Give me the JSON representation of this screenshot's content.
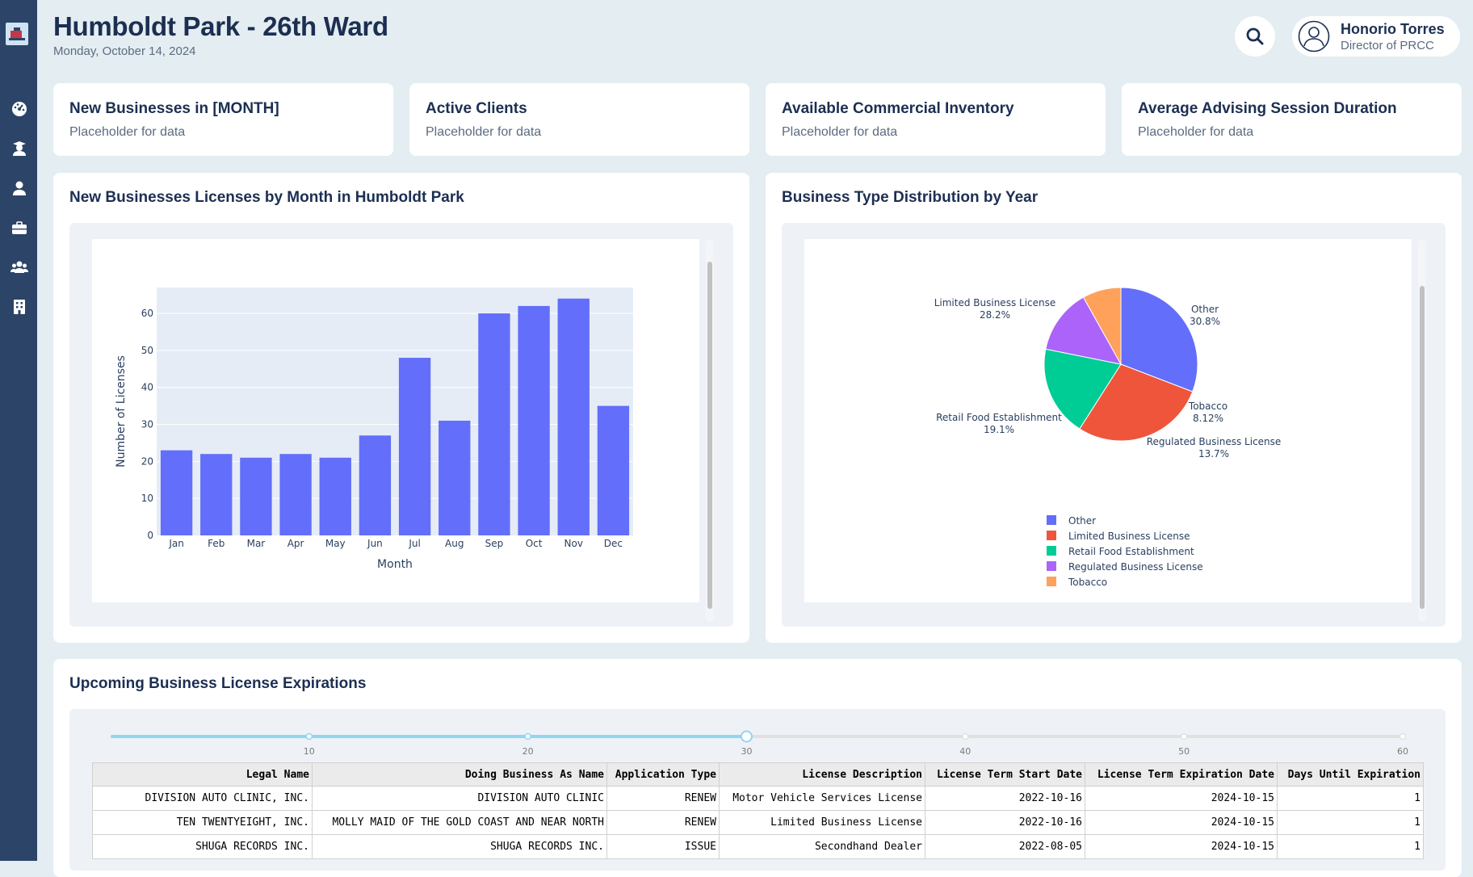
{
  "header": {
    "title": "Humboldt Park - 26th Ward",
    "date": "Monday, October 14, 2024"
  },
  "user": {
    "name": "Honorio Torres",
    "role": "Director of PRCC"
  },
  "sidebar": {
    "items": [
      {
        "icon": "dashboard-icon"
      },
      {
        "icon": "graduate-icon"
      },
      {
        "icon": "user-icon"
      },
      {
        "icon": "briefcase-icon"
      },
      {
        "icon": "users-icon"
      },
      {
        "icon": "building-icon"
      }
    ]
  },
  "kpis": [
    {
      "title": "New Businesses in [MONTH]",
      "value": "Placeholder for data"
    },
    {
      "title": "Active Clients",
      "value": "Placeholder for data"
    },
    {
      "title": "Available Commercial Inventory",
      "value": "Placeholder for data"
    },
    {
      "title": "Average Advising Session Duration",
      "value": "Placeholder for data"
    }
  ],
  "colors": {
    "bar": "#636efa",
    "plot_bg": "#e5ecf6",
    "sidebar": "#2c4468",
    "slider": "#8fd6f2"
  },
  "chart_data": [
    {
      "type": "bar",
      "title": "New Businesses Licenses by Month in Humboldt Park",
      "xlabel": "Month",
      "ylabel": "Number of Licenses",
      "categories": [
        "Jan",
        "Feb",
        "Mar",
        "Apr",
        "May",
        "Jun",
        "Jul",
        "Aug",
        "Sep",
        "Oct",
        "Nov",
        "Dec"
      ],
      "values": [
        23,
        22,
        21,
        22,
        21,
        27,
        48,
        31,
        60,
        62,
        64,
        35
      ],
      "ylim": [
        0,
        67
      ],
      "yticks": [
        0,
        10,
        20,
        30,
        40,
        50,
        60
      ],
      "grid": true
    },
    {
      "type": "pie",
      "title": "Business Type Distribution by Year",
      "labels": [
        "Other",
        "Limited Business License",
        "Retail Food Establishment",
        "Regulated Business License",
        "Tobacco"
      ],
      "values": [
        30.8,
        28.2,
        19.1,
        13.7,
        8.12
      ],
      "value_labels": [
        "30.8%",
        "28.2%",
        "19.1%",
        "13.7%",
        "8.12%"
      ],
      "colors": [
        "#636efa",
        "#ef553b",
        "#00cc96",
        "#ab63fa",
        "#ffa15a"
      ],
      "legend": "bottom"
    }
  ],
  "expirations": {
    "title": "Upcoming Business License Expirations",
    "slider": {
      "ticks": [
        "10",
        "20",
        "30",
        "40",
        "50",
        "60"
      ],
      "value": 30,
      "min": 1,
      "max": 60
    },
    "columns": [
      "Legal Name",
      "Doing Business As Name",
      "Application Type",
      "License Description",
      "License Term Start Date",
      "License Term Expiration Date",
      "Days Until Expiration"
    ],
    "rows": [
      [
        "DIVISION AUTO CLINIC, INC.",
        "DIVISION AUTO CLINIC",
        "RENEW",
        "Motor Vehicle Services License",
        "2022-10-16",
        "2024-10-15",
        "1"
      ],
      [
        "TEN TWENTYEIGHT, INC.",
        "MOLLY MAID OF THE GOLD COAST AND NEAR NORTH",
        "RENEW",
        "Limited Business License",
        "2022-10-16",
        "2024-10-15",
        "1"
      ],
      [
        "SHUGA RECORDS INC.",
        "SHUGA RECORDS INC.",
        "ISSUE",
        "Secondhand Dealer",
        "2022-08-05",
        "2024-10-15",
        "1"
      ]
    ]
  }
}
